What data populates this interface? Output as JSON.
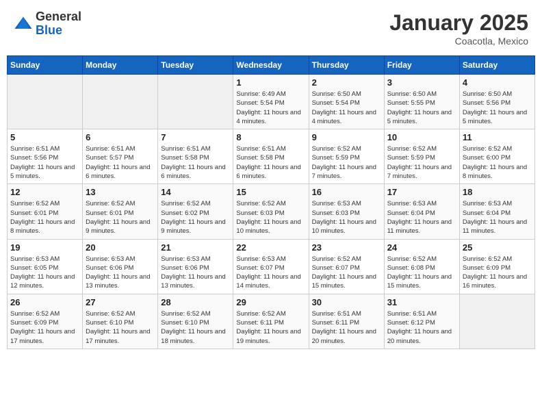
{
  "header": {
    "logo_general": "General",
    "logo_blue": "Blue",
    "month": "January 2025",
    "location": "Coacotla, Mexico"
  },
  "days_of_week": [
    "Sunday",
    "Monday",
    "Tuesday",
    "Wednesday",
    "Thursday",
    "Friday",
    "Saturday"
  ],
  "weeks": [
    [
      {
        "day": "",
        "info": ""
      },
      {
        "day": "",
        "info": ""
      },
      {
        "day": "",
        "info": ""
      },
      {
        "day": "1",
        "info": "Sunrise: 6:49 AM\nSunset: 5:54 PM\nDaylight: 11 hours and 4 minutes."
      },
      {
        "day": "2",
        "info": "Sunrise: 6:50 AM\nSunset: 5:54 PM\nDaylight: 11 hours and 4 minutes."
      },
      {
        "day": "3",
        "info": "Sunrise: 6:50 AM\nSunset: 5:55 PM\nDaylight: 11 hours and 5 minutes."
      },
      {
        "day": "4",
        "info": "Sunrise: 6:50 AM\nSunset: 5:56 PM\nDaylight: 11 hours and 5 minutes."
      }
    ],
    [
      {
        "day": "5",
        "info": "Sunrise: 6:51 AM\nSunset: 5:56 PM\nDaylight: 11 hours and 5 minutes."
      },
      {
        "day": "6",
        "info": "Sunrise: 6:51 AM\nSunset: 5:57 PM\nDaylight: 11 hours and 6 minutes."
      },
      {
        "day": "7",
        "info": "Sunrise: 6:51 AM\nSunset: 5:58 PM\nDaylight: 11 hours and 6 minutes."
      },
      {
        "day": "8",
        "info": "Sunrise: 6:51 AM\nSunset: 5:58 PM\nDaylight: 11 hours and 6 minutes."
      },
      {
        "day": "9",
        "info": "Sunrise: 6:52 AM\nSunset: 5:59 PM\nDaylight: 11 hours and 7 minutes."
      },
      {
        "day": "10",
        "info": "Sunrise: 6:52 AM\nSunset: 5:59 PM\nDaylight: 11 hours and 7 minutes."
      },
      {
        "day": "11",
        "info": "Sunrise: 6:52 AM\nSunset: 6:00 PM\nDaylight: 11 hours and 8 minutes."
      }
    ],
    [
      {
        "day": "12",
        "info": "Sunrise: 6:52 AM\nSunset: 6:01 PM\nDaylight: 11 hours and 8 minutes."
      },
      {
        "day": "13",
        "info": "Sunrise: 6:52 AM\nSunset: 6:01 PM\nDaylight: 11 hours and 9 minutes."
      },
      {
        "day": "14",
        "info": "Sunrise: 6:52 AM\nSunset: 6:02 PM\nDaylight: 11 hours and 9 minutes."
      },
      {
        "day": "15",
        "info": "Sunrise: 6:52 AM\nSunset: 6:03 PM\nDaylight: 11 hours and 10 minutes."
      },
      {
        "day": "16",
        "info": "Sunrise: 6:53 AM\nSunset: 6:03 PM\nDaylight: 11 hours and 10 minutes."
      },
      {
        "day": "17",
        "info": "Sunrise: 6:53 AM\nSunset: 6:04 PM\nDaylight: 11 hours and 11 minutes."
      },
      {
        "day": "18",
        "info": "Sunrise: 6:53 AM\nSunset: 6:04 PM\nDaylight: 11 hours and 11 minutes."
      }
    ],
    [
      {
        "day": "19",
        "info": "Sunrise: 6:53 AM\nSunset: 6:05 PM\nDaylight: 11 hours and 12 minutes."
      },
      {
        "day": "20",
        "info": "Sunrise: 6:53 AM\nSunset: 6:06 PM\nDaylight: 11 hours and 13 minutes."
      },
      {
        "day": "21",
        "info": "Sunrise: 6:53 AM\nSunset: 6:06 PM\nDaylight: 11 hours and 13 minutes."
      },
      {
        "day": "22",
        "info": "Sunrise: 6:53 AM\nSunset: 6:07 PM\nDaylight: 11 hours and 14 minutes."
      },
      {
        "day": "23",
        "info": "Sunrise: 6:52 AM\nSunset: 6:07 PM\nDaylight: 11 hours and 15 minutes."
      },
      {
        "day": "24",
        "info": "Sunrise: 6:52 AM\nSunset: 6:08 PM\nDaylight: 11 hours and 15 minutes."
      },
      {
        "day": "25",
        "info": "Sunrise: 6:52 AM\nSunset: 6:09 PM\nDaylight: 11 hours and 16 minutes."
      }
    ],
    [
      {
        "day": "26",
        "info": "Sunrise: 6:52 AM\nSunset: 6:09 PM\nDaylight: 11 hours and 17 minutes."
      },
      {
        "day": "27",
        "info": "Sunrise: 6:52 AM\nSunset: 6:10 PM\nDaylight: 11 hours and 17 minutes."
      },
      {
        "day": "28",
        "info": "Sunrise: 6:52 AM\nSunset: 6:10 PM\nDaylight: 11 hours and 18 minutes."
      },
      {
        "day": "29",
        "info": "Sunrise: 6:52 AM\nSunset: 6:11 PM\nDaylight: 11 hours and 19 minutes."
      },
      {
        "day": "30",
        "info": "Sunrise: 6:51 AM\nSunset: 6:11 PM\nDaylight: 11 hours and 20 minutes."
      },
      {
        "day": "31",
        "info": "Sunrise: 6:51 AM\nSunset: 6:12 PM\nDaylight: 11 hours and 20 minutes."
      },
      {
        "day": "",
        "info": ""
      }
    ]
  ]
}
